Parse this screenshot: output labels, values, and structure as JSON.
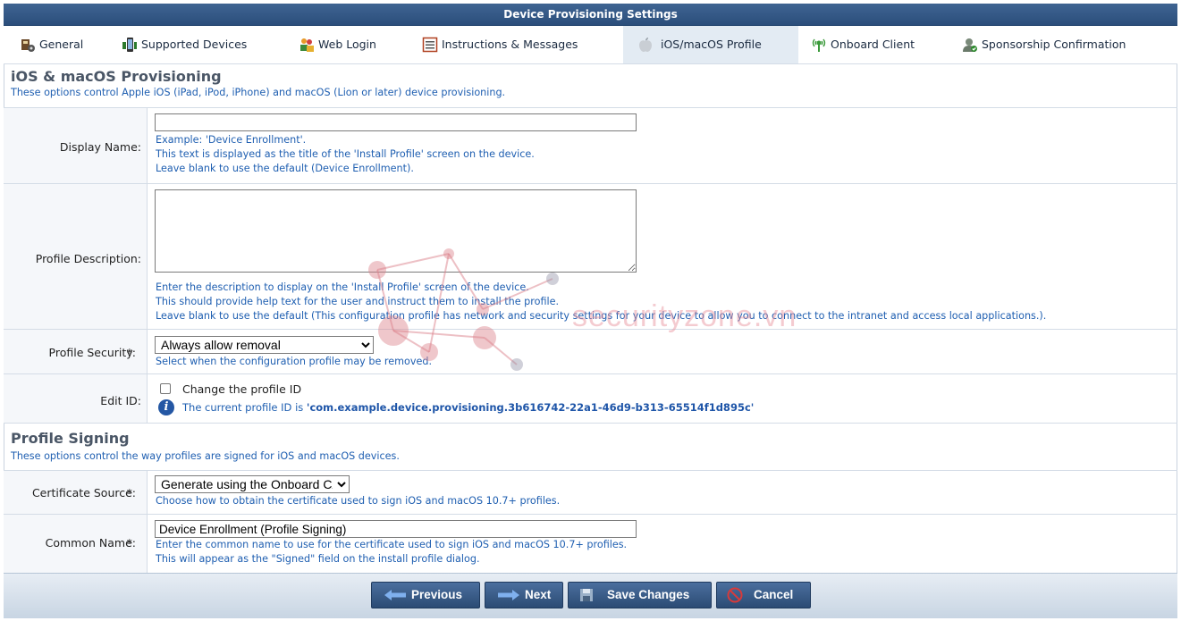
{
  "header": {
    "title": "Device Provisioning Settings"
  },
  "tabs": [
    {
      "label": "General",
      "icon": "general-icon",
      "active": false
    },
    {
      "label": "Supported Devices",
      "icon": "devices-icon",
      "active": false
    },
    {
      "label": "Web Login",
      "icon": "web-login-icon",
      "active": false
    },
    {
      "label": "Instructions & Messages",
      "icon": "instructions-icon",
      "active": false
    },
    {
      "label": "iOS/macOS Profile",
      "icon": "apple-icon",
      "active": true
    },
    {
      "label": "Onboard Client",
      "icon": "onboard-client-icon",
      "active": false
    },
    {
      "label": "Sponsorship Confirmation",
      "icon": "sponsorship-icon",
      "active": false
    }
  ],
  "ios_section": {
    "title": "iOS & macOS Provisioning",
    "subtitle": "These options control Apple iOS (iPad, iPod, iPhone) and macOS (Lion or later) device provisioning."
  },
  "display_name": {
    "label": "Display Name:",
    "value": "",
    "help": [
      "Example: 'Device Enrollment'.",
      "This text is displayed as the title of the 'Install Profile' screen on the device.",
      "Leave blank to use the default (Device Enrollment)."
    ]
  },
  "profile_description": {
    "label": "Profile Description:",
    "value": "",
    "help": [
      "Enter the description to display on the 'Install Profile' screen of the device.",
      "This should provide help text for the user and instruct them to install the profile.",
      "Leave blank to use the default (This configuration profile has network and security settings for your device to allow you to connect to the intranet and access local applications.)."
    ]
  },
  "profile_security": {
    "required_mark": "*",
    "label": "Profile Security:",
    "selected": "Always allow removal",
    "help": "Select when the configuration profile may be removed."
  },
  "edit_id": {
    "label": "Edit ID:",
    "checkbox_label": "Change the profile ID",
    "checked": false,
    "info_prefix": "The current profile ID is ",
    "profile_id": "'com.example.device.provisioning.3b616742-22a1-46d9-b313-65514f1d895c'"
  },
  "signing_section": {
    "title": "Profile Signing",
    "subtitle": "These options control the way profiles are signed for iOS and macOS devices."
  },
  "certificate_source": {
    "required_mark": "*",
    "label": "Certificate Source:",
    "selected": "Generate using the Onboard CA",
    "help": "Choose how to obtain the certificate used to sign iOS and macOS 10.7+ profiles."
  },
  "common_name": {
    "required_mark": "*",
    "label": "Common Name:",
    "value": "Device Enrollment (Profile Signing)",
    "help": [
      "Enter the common name to use for the certificate used to sign iOS and macOS 10.7+ profiles.",
      "This will appear as the \"Signed\" field on the install profile dialog."
    ]
  },
  "footer": {
    "previous_label": "Previous",
    "next_label": "Next",
    "save_label": "Save Changes",
    "cancel_label": "Cancel"
  },
  "watermark": {
    "text": "securityzone.vn"
  },
  "colors": {
    "header_bg": "#2b4e7b",
    "help_text": "#1f5fb1",
    "active_tab": "#e3ebf3",
    "button_bg": "#2b4b74"
  }
}
